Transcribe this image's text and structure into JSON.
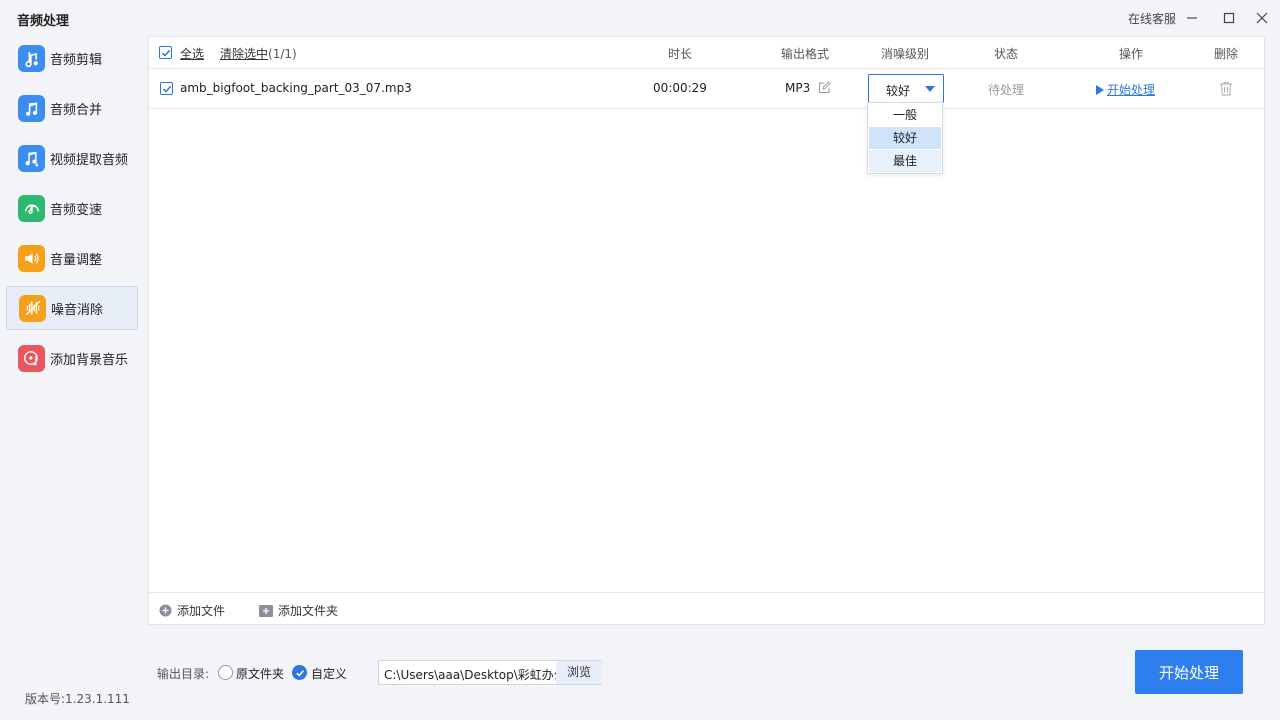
{
  "window": {
    "title": "音频处理",
    "service_label": "在线客服"
  },
  "sidebar": {
    "items": [
      {
        "label": "音频剪辑",
        "icon": "audio-cut-icon",
        "color": "#3b8ef0"
      },
      {
        "label": "音频合并",
        "icon": "audio-merge-icon",
        "color": "#3b8ef0"
      },
      {
        "label": "视频提取音频",
        "icon": "video-extract-audio-icon",
        "color": "#3b8ef0"
      },
      {
        "label": "音频变速",
        "icon": "audio-speed-icon",
        "color": "#2eb872"
      },
      {
        "label": "音量调整",
        "icon": "volume-icon",
        "color": "#f5a01a"
      },
      {
        "label": "噪音消除",
        "icon": "noise-reduction-icon",
        "color": "#f5a01a",
        "active": true
      },
      {
        "label": "添加背景音乐",
        "icon": "background-music-icon",
        "color": "#e8565f"
      }
    ],
    "version": "版本号:1.23.1.111"
  },
  "table": {
    "select_all": "全选",
    "clear_selected": "清除选中",
    "count": "(1/1)",
    "headers": {
      "duration": "时长",
      "format": "输出格式",
      "level": "消噪级别",
      "status": "状态",
      "action": "操作",
      "delete": "删除"
    },
    "rows": [
      {
        "filename": "amb_bigfoot_backing_part_03_07.mp3",
        "duration": "00:00:29",
        "format": "MP3",
        "level": "较好",
        "status": "待处理",
        "action": "开始处理"
      }
    ]
  },
  "level_dropdown": {
    "options": [
      "一般",
      "较好",
      "最佳"
    ],
    "selected": "较好"
  },
  "footer": {
    "add_file": "添加文件",
    "add_folder": "添加文件夹"
  },
  "output": {
    "label": "输出目录:",
    "option_original": "原文件夹",
    "option_custom": "自定义",
    "selected": "自定义",
    "path": "C:\\Users\\aaa\\Desktop\\彩虹办公",
    "browse": "浏览"
  },
  "start_button": "开始处理",
  "colors": {
    "accent": "#2e7ef0",
    "selected_option_bg": "#cfe3fb",
    "hover_option_bg": "#e6f1fc"
  }
}
